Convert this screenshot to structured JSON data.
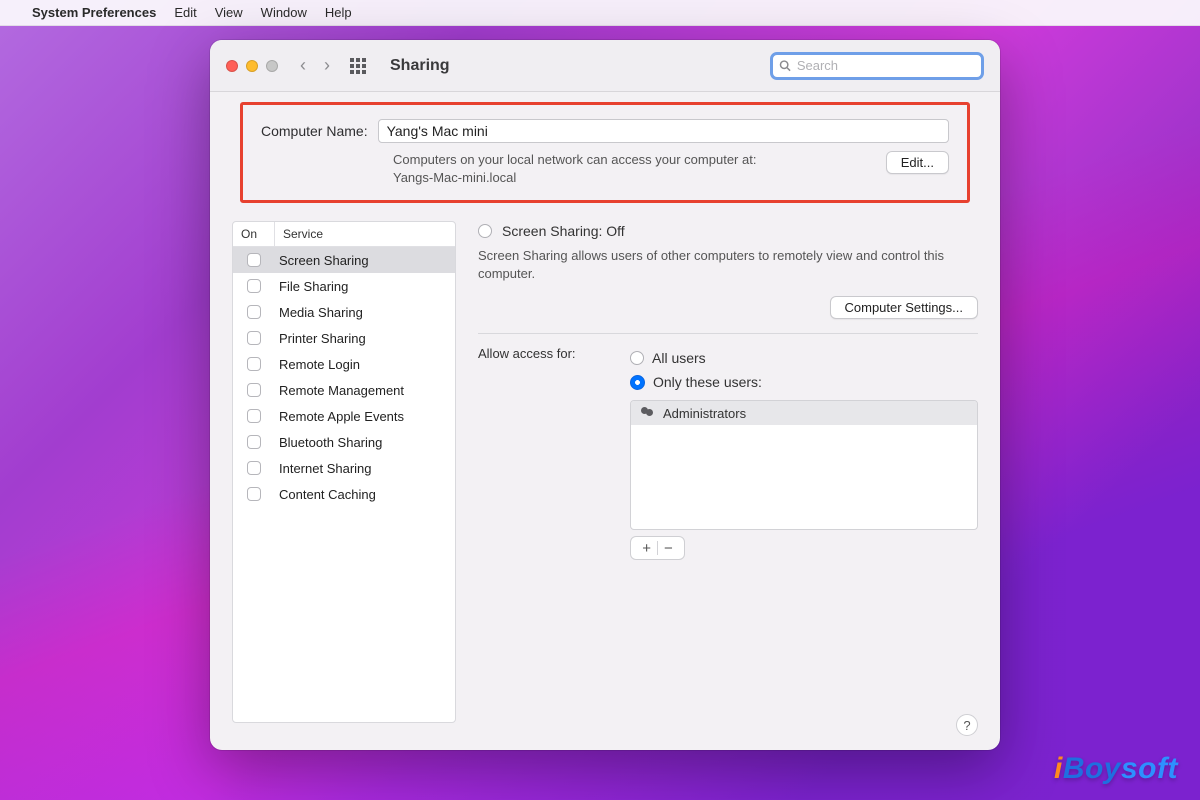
{
  "menubar": {
    "apple_symbol": "",
    "app_name": "System Preferences",
    "items": [
      "Edit",
      "View",
      "Window",
      "Help"
    ]
  },
  "window": {
    "title": "Sharing",
    "search_placeholder": "Search"
  },
  "computer_name": {
    "label": "Computer Name:",
    "value": "Yang's Mac mini",
    "sub_line1": "Computers on your local network can access your computer at:",
    "sub_line2": "Yangs-Mac-mini.local",
    "edit_label": "Edit..."
  },
  "services": {
    "col_on": "On",
    "col_service": "Service",
    "items": [
      {
        "label": "Screen Sharing",
        "checked": false,
        "selected": true
      },
      {
        "label": "File Sharing",
        "checked": false,
        "selected": false
      },
      {
        "label": "Media Sharing",
        "checked": false,
        "selected": false
      },
      {
        "label": "Printer Sharing",
        "checked": false,
        "selected": false
      },
      {
        "label": "Remote Login",
        "checked": false,
        "selected": false
      },
      {
        "label": "Remote Management",
        "checked": false,
        "selected": false
      },
      {
        "label": "Remote Apple Events",
        "checked": false,
        "selected": false
      },
      {
        "label": "Bluetooth Sharing",
        "checked": false,
        "selected": false
      },
      {
        "label": "Internet Sharing",
        "checked": false,
        "selected": false
      },
      {
        "label": "Content Caching",
        "checked": false,
        "selected": false
      }
    ]
  },
  "detail": {
    "header": "Screen Sharing: Off",
    "description": "Screen Sharing allows users of other computers to remotely view and control this computer.",
    "computer_settings_label": "Computer Settings...",
    "access_label": "Allow access for:",
    "opt_all": "All users",
    "opt_only": "Only these users:",
    "users": [
      "Administrators"
    ],
    "add_symbol": "+",
    "remove_symbol": "−",
    "help_symbol": "?"
  },
  "watermark": {
    "i": "i",
    "bo": "Boy",
    "soft": "soft"
  }
}
